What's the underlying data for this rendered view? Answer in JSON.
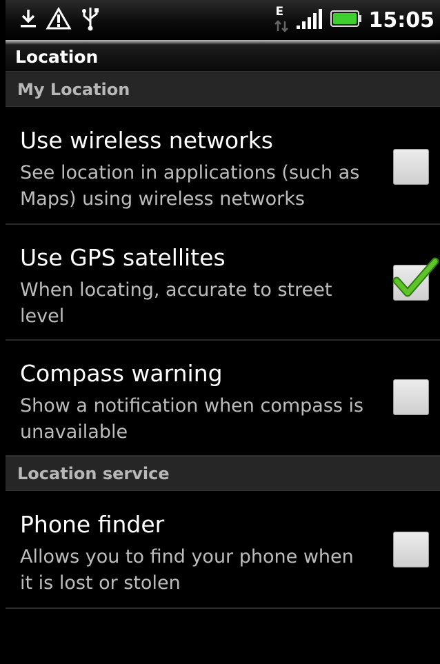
{
  "status_bar": {
    "time": "15:05",
    "network_type": "E",
    "icons": [
      "download-icon",
      "warning-icon",
      "usb-icon",
      "data-arrows-icon",
      "signal-icon",
      "battery-icon"
    ],
    "battery_color": "#3fcf2f"
  },
  "title_bar": {
    "title": "Location"
  },
  "sections": [
    {
      "header": "My Location",
      "items": [
        {
          "title": "Use wireless networks",
          "subtitle": "See location in applications (such as Maps) using wireless networks",
          "checked": false
        },
        {
          "title": "Use GPS satellites",
          "subtitle": "When locating, accurate to street level",
          "checked": true
        },
        {
          "title": "Compass warning",
          "subtitle": "Show a notification when compass is unavailable",
          "checked": false
        }
      ]
    },
    {
      "header": "Location service",
      "items": [
        {
          "title": "Phone finder",
          "subtitle": "Allows you to find your phone when it is lost or stolen",
          "checked": false
        }
      ]
    }
  ],
  "colors": {
    "check_mark": "#5ec42a",
    "section_header_text": "#b8b8b8",
    "subtitle_text": "#bdbdbd"
  }
}
